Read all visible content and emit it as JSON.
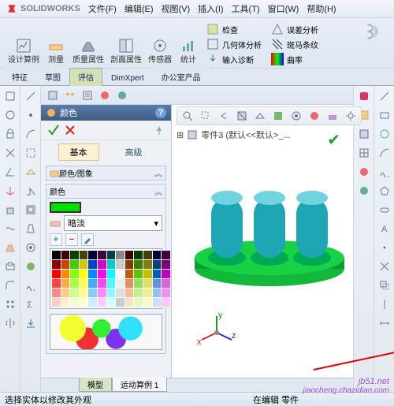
{
  "app": {
    "name": "SOLIDWORKS"
  },
  "menu": {
    "file": "文件(F)",
    "edit": "编辑(E)",
    "view": "视图(V)",
    "insert": "插入(I)",
    "tools": "工具(T)",
    "window": "窗口(W)",
    "help": "帮助(H)"
  },
  "ribbon": {
    "design": "设计算例",
    "measure": "测量",
    "mass": "质量属性",
    "section": "剖面属性",
    "sensor": "传感器",
    "stats": "统计",
    "check": "检查",
    "geom": "几何体分析",
    "import": "输入诊断",
    "err": "误差分析",
    "zebra": "斑马条纹",
    "curv": "曲率"
  },
  "tabs": {
    "feature": "特征",
    "sketch": "草图",
    "eval": "评估",
    "dimxpert": "DimXpert",
    "office": "办公室产品"
  },
  "colorPanel": {
    "title": "颜色",
    "help": "?",
    "basic": "基本",
    "advanced": "高级",
    "section1": "颜色/图象",
    "sectionColor": "颜色",
    "shade": "暗淡"
  },
  "tree": {
    "part": "零件3 (默认<<默认>_..."
  },
  "palette": {
    "colors": [
      "#000",
      "#400",
      "#040",
      "#440",
      "#004",
      "#404",
      "#044",
      "#888",
      "#400000",
      "#004000",
      "#404000",
      "#000040",
      "#400040",
      "#800",
      "#c40",
      "#4c0",
      "#cc0",
      "#04c",
      "#c0c",
      "#0cc",
      "#ccc",
      "#804000",
      "#408000",
      "#808000",
      "#004080",
      "#800080",
      "#f00",
      "#f80",
      "#8f0",
      "#ff0",
      "#08f",
      "#f0f",
      "#0ff",
      "#fff",
      "#c06000",
      "#60c000",
      "#c0c000",
      "#0060c0",
      "#c000c0",
      "#f44",
      "#fa4",
      "#af4",
      "#ff4",
      "#4af",
      "#f4f",
      "#4ff",
      "#eee",
      "#e09060",
      "#90e060",
      "#e0e060",
      "#6090e0",
      "#e060e0",
      "#f88",
      "#fc8",
      "#cf8",
      "#ff8",
      "#8cf",
      "#f8f",
      "#8ff",
      "#ddd",
      "#f0c090",
      "#c0f090",
      "#f0f090",
      "#90c0f0",
      "#f090f0",
      "#fcc",
      "#fec",
      "#efc",
      "#ffc",
      "#cef",
      "#fcf",
      "#cff",
      "#ccc",
      "#f8e0c8",
      "#e0f8c8",
      "#f8f8c8",
      "#c8e0f8",
      "#f8c8f8"
    ],
    "current": "#00e000"
  },
  "bottomTabs": {
    "model": "模型",
    "motion": "运动算例 1"
  },
  "status": {
    "hint": "选择实体以修改其外观",
    "mode": "在编辑 零件"
  },
  "watermark": {
    "l1": "jb51.net",
    "l2": "jiaocheng.chazidian.com"
  }
}
